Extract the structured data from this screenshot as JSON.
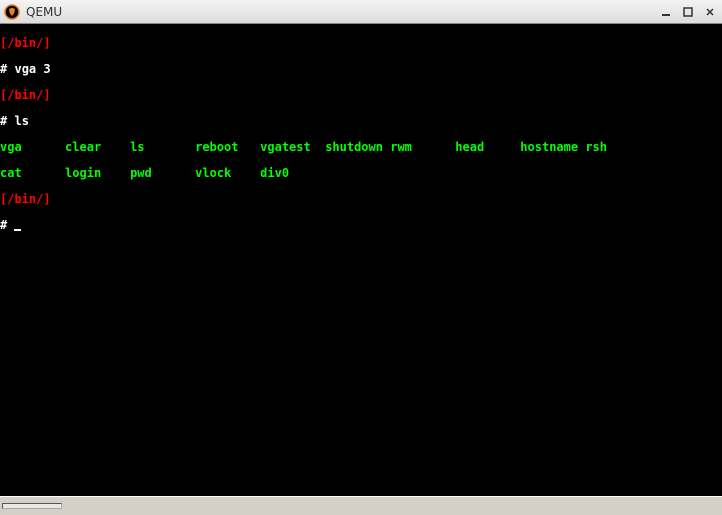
{
  "window": {
    "title": "QEMU"
  },
  "terminal": {
    "prompt_path": "[/bin/]",
    "prompt_symbol": "#",
    "commands": {
      "vga": "vga 3",
      "ls": "ls"
    },
    "ls_output": {
      "row1": [
        "vga",
        "clear",
        "ls",
        "reboot",
        "vgatest",
        "shutdown",
        "rwm",
        "head",
        "hostname",
        "rsh"
      ],
      "row2": [
        "cat",
        "login",
        "pwd",
        "vlock",
        "div0"
      ]
    }
  }
}
